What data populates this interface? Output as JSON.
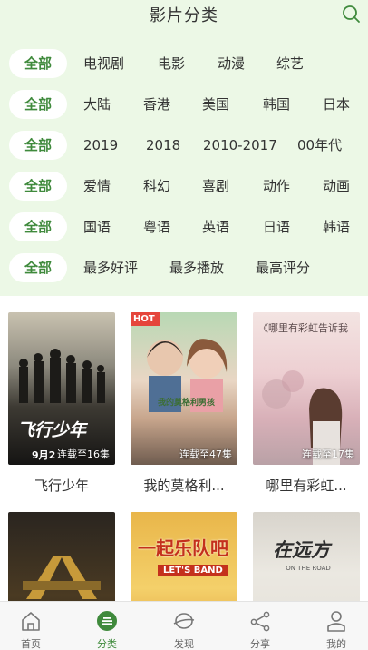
{
  "header": {
    "title": "影片分类"
  },
  "filters": {
    "all_label": "全部",
    "rows": [
      [
        "电视剧",
        "电影",
        "动漫",
        "综艺"
      ],
      [
        "大陆",
        "香港",
        "美国",
        "韩国",
        "日本"
      ],
      [
        "2019",
        "2018",
        "2010-2017",
        "00年代"
      ],
      [
        "爱情",
        "科幻",
        "喜剧",
        "动作",
        "动画"
      ],
      [
        "国语",
        "粤语",
        "英语",
        "日语",
        "韩语"
      ],
      [
        "最多好评",
        "最多播放",
        "最高评分"
      ]
    ]
  },
  "movies": [
    {
      "title": "飞行少年",
      "badge": "连载至16集",
      "poster_text": "飞行少年",
      "poster_sub": "9月2"
    },
    {
      "title": "我的莫格利...",
      "badge": "连载至47集",
      "hot": "HOT",
      "poster_text": "我的莫格利男孩"
    },
    {
      "title": "哪里有彩虹...",
      "badge": "连载至17集",
      "poster_text": "《哪里有彩虹告诉我"
    },
    {
      "title": "",
      "poster_text": ""
    },
    {
      "title": "",
      "poster_text": "一起乐队吧",
      "poster_sub": "LET'S BAND"
    },
    {
      "title": "",
      "poster_text": "在远方",
      "poster_sub": "ON THE ROAD"
    }
  ],
  "tabs": [
    {
      "label": "首页",
      "icon": "home-icon"
    },
    {
      "label": "分类",
      "icon": "category-icon"
    },
    {
      "label": "发现",
      "icon": "discover-icon"
    },
    {
      "label": "分享",
      "icon": "share-icon"
    },
    {
      "label": "我的",
      "icon": "profile-icon"
    }
  ],
  "colors": {
    "accent": "#3f8a3c",
    "filter_bg": "#ecf8e6",
    "tabbar_bg": "#f7f7f7"
  }
}
